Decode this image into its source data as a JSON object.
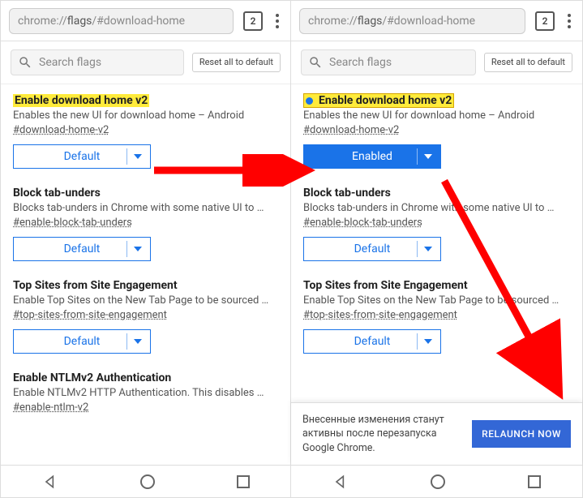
{
  "omnibox": {
    "prefix": "chrome://",
    "bold": "flags",
    "suffix": "/#download-home"
  },
  "tab_count": "2",
  "search": {
    "placeholder": "Search flags"
  },
  "reset_button": "Reset all to default",
  "flags": {
    "f1": {
      "title": "Enable download home v2",
      "desc": "Enables the new UI for download home – Android",
      "hash": "#download-home-v2",
      "value_default": "Default",
      "value_enabled": "Enabled"
    },
    "f2": {
      "title": "Block tab-unders",
      "desc": "Blocks tab-unders in Chrome with some native UI to …",
      "hash": "#enable-block-tab-unders",
      "value": "Default"
    },
    "f3": {
      "title": "Top Sites from Site Engagement",
      "desc": "Enable Top Sites on the New Tab Page to be sourced …",
      "hash": "#top-sites-from-site-engagement",
      "value": "Default"
    },
    "f4": {
      "title": "Enable NTLMv2 Authentication",
      "desc": "Enable NTLMv2 HTTP Authentication. This disables …",
      "hash": "#enable-ntlm-v2"
    }
  },
  "relaunch": {
    "message": "Внесенные изменения станут активны после перезапуска Google Chrome.",
    "button": "RELAUNCH NOW"
  },
  "colors": {
    "accent": "#1a73e8",
    "highlight": "#ffeb3b",
    "arrow": "#ff0000"
  }
}
